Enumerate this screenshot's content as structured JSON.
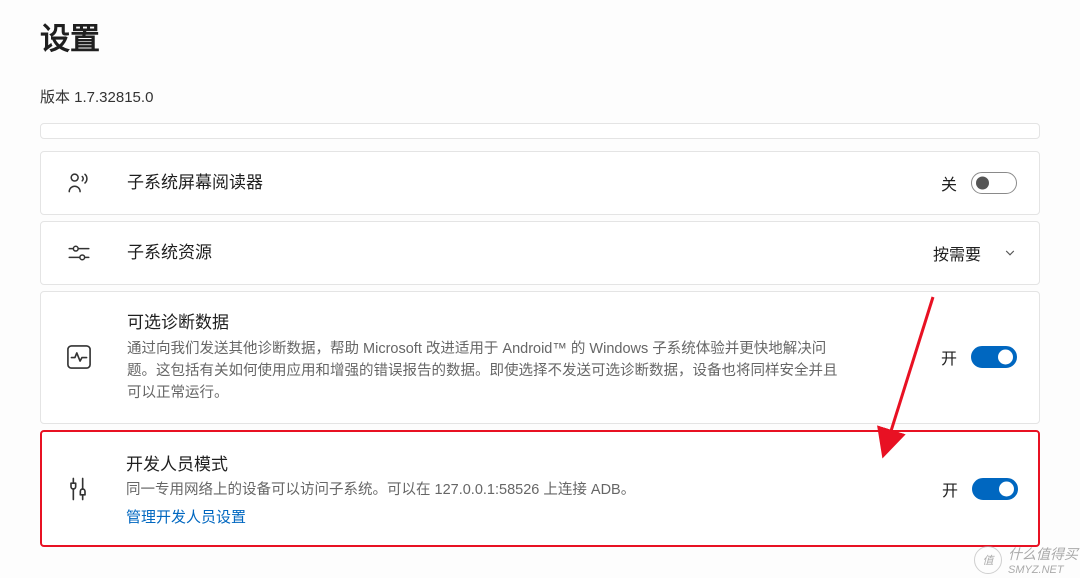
{
  "page": {
    "title": "设置",
    "version": "版本 1.7.32815.0"
  },
  "rows": {
    "screenReader": {
      "title": "子系统屏幕阅读器",
      "status": "关"
    },
    "resources": {
      "title": "子系统资源",
      "status": "按需要"
    },
    "diagnostic": {
      "title": "可选诊断数据",
      "desc": "通过向我们发送其他诊断数据，帮助 Microsoft 改进适用于 Android™ 的 Windows 子系统体验并更快地解决问题。这包括有关如何使用应用和增强的错误报告的数据。即使选择不发送可选诊断数据，设备也将同样安全并且可以正常运行。",
      "status": "开"
    },
    "developer": {
      "title": "开发人员模式",
      "desc": "同一专用网络上的设备可以访问子系统。可以在 127.0.0.1:58526 上连接 ADB。",
      "link": "管理开发人员设置",
      "status": "开"
    }
  },
  "watermark": {
    "logo": "值",
    "text1": "什么值得买",
    "text2": "SMYZ.NET"
  }
}
